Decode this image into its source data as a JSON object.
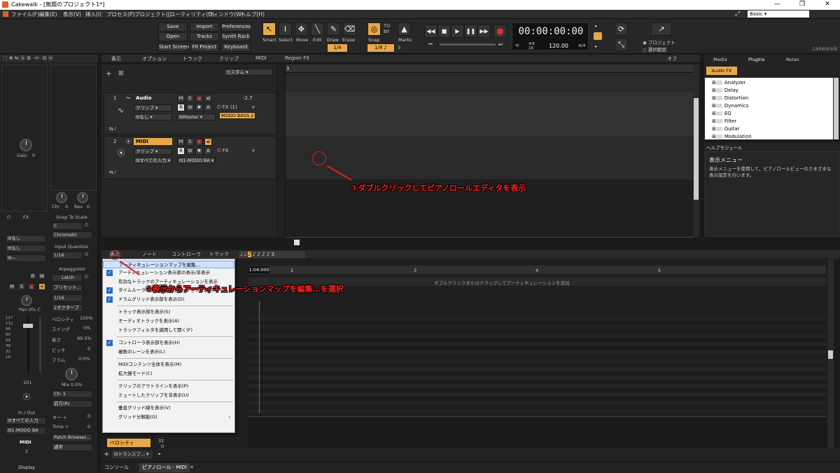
{
  "window": {
    "title": "Cakewalk - [無題のプロジェクト1*]",
    "min": "—",
    "max": "❐",
    "close": "✕",
    "workspace": "Basic"
  },
  "menu": [
    "ファイル(F)",
    "編集(E)",
    "表示(V)",
    "挿入(I)",
    "プロセス(P)",
    "プロジェクト(J)",
    "ユーティリティ(U)",
    "ウィンドウ(W)",
    "ヘルプ(H)"
  ],
  "control": {
    "buttons": [
      "Save",
      "Import",
      "Preferences",
      "Open",
      "Tracks",
      "Synth Rack",
      "Start Screen",
      "Fit Project",
      "Keyboard"
    ],
    "tools": [
      "Smart",
      "Select",
      "Move",
      "Edit",
      "Draw",
      "Erase"
    ],
    "snap": {
      "label": "Snap",
      "value": "1/8",
      "quantize": "1/4",
      "marks": "Marks"
    },
    "time": "00:00:00:00",
    "tempo": "120.00",
    "meter": "4/4",
    "meter_alt": "4/8",
    "meter_sub": "16",
    "beats_label": "3",
    "radio_project": "プロジェクト",
    "radio_selection": "選択範囲",
    "brand": "cakewalk"
  },
  "inspector": {
    "gain": "Gain",
    "gain_val": "0",
    "chr": "Chr",
    "chr_val": "0",
    "rev": "Rev",
    "rev_val": "0",
    "fx": "FX",
    "snap_to_scale": "Snap To Scale",
    "scale_key": "C",
    "scale_type": "Chromatic",
    "none1": "なし",
    "none2": "なし",
    "dash": "---",
    "input_quantize": "Input Quantize",
    "iq_value": "1/16",
    "arpeggiator": "Arpeggiator",
    "latch": "Latch",
    "preset": "プリセット…",
    "arp_rate": "1/16",
    "arp_octave": "2オクターブ",
    "pan": "Pan",
    "pan_val": "0% C",
    "velocity": "ベロシティ",
    "velocity_val": "100%",
    "swing": "スイング",
    "swing_val": "0%",
    "length": "長さ",
    "length_val": "99.5%",
    "pitch": "ピッチ",
    "pitch_val": "0",
    "flam": "フラム",
    "flam_val": "0.0%",
    "mix": "Mix",
    "mix_val": "0.0%",
    "ch": "Ch: 1",
    "direction": "前方(R)",
    "key_plus": "キー +",
    "key_val": "0",
    "time_plus": "Time +",
    "time_val": "0",
    "patch_browser": "Patch Browser...",
    "normal": "通常",
    "in_out": "In / Out",
    "input_all": "すべての入力",
    "output": "1-MODO BA",
    "track_type": "MIDI",
    "track_num": "2",
    "display": "Display",
    "fader_scale": [
      "127",
      "112",
      "96",
      "80",
      "64",
      "48",
      "32",
      "16"
    ],
    "fader_val": "101"
  },
  "trackview": {
    "menus": [
      "表示",
      "オプション",
      "トラック",
      "クリップ",
      "MIDI",
      "Region FX"
    ],
    "custom": "カスタム",
    "off": "オフ",
    "tracks": [
      {
        "num": "1",
        "name": "Audio",
        "vol": "-2.7",
        "clip": "クリップ",
        "fx": "FX (1)",
        "input": "なし",
        "output": "Master",
        "plugin": "MODO BASS 2"
      },
      {
        "num": "2",
        "name": "MIDI",
        "clip": "クリップ",
        "fx": "FX",
        "input": "すべての入力",
        "output": "1-MODO BA"
      }
    ],
    "annotation1": "①ダブルクリックしてピアノロールエディタを表示"
  },
  "browser": {
    "tabs": [
      "Media",
      "PlugIns",
      "Notes"
    ],
    "category": "Audio FX",
    "items": [
      "Analyzer",
      "Delay",
      "Distortion",
      "Dynamics",
      "EQ",
      "Filter",
      "Guitar",
      "Modulation"
    ]
  },
  "help": {
    "title": "ヘルプモジュール",
    "heading": "表示メニュー",
    "body": "表示メニューを使用して、ピアノロールビューのさまざまな表示設定を行います。"
  },
  "pianoroll": {
    "menus": [
      "表示",
      "ノート",
      "コントローラ",
      "トラック"
    ],
    "time": "1:04:000",
    "bars": [
      "2",
      "3",
      "4",
      "5"
    ],
    "hint": "ダブルクリックまたはドラッグしてアーティキュレーションを追加",
    "velocity": "ベロシティ",
    "transform": "トランスフ...",
    "ctl_val": "32",
    "ctl_zero": "0",
    "annotation2": "②表示からアーティキュレーションマップを編集…を選択"
  },
  "dropdown": [
    {
      "label": "アーティキュレーションマップを編集...",
      "checked": false,
      "highlight": true
    },
    {
      "label": "アーティキュレーション表示部の表示/非表示",
      "checked": true
    },
    {
      "label": "有効なトラックのアーティキュレーションを表示",
      "checked": false
    },
    {
      "label": "タイムルーラでアーティキュレーションを選択",
      "checked": true
    },
    {
      "label": "ドラムグリッド表示部を表示(D)",
      "checked": true
    },
    {
      "label": "トラック表示部を表示(S)",
      "checked": false
    },
    {
      "label": "オーディオトラックを表示(A)",
      "checked": false
    },
    {
      "label": "トラックフィルタを適用して開く(F)",
      "checked": false
    },
    {
      "label": "コントローラ表示部を表示(H)",
      "checked": true
    },
    {
      "label": "複数のレーンを表示(L)",
      "checked": false
    },
    {
      "label": "MIDIコンテンツ全体を表示(M)",
      "checked": false
    },
    {
      "label": "拡大鏡モード(C)",
      "checked": false
    },
    {
      "label": "クリップのアウトラインを表示(P)",
      "checked": false
    },
    {
      "label": "ミュートしたクリップを非表示(U)",
      "checked": false
    },
    {
      "label": "垂直グリッド線を表示(V)",
      "checked": false
    },
    {
      "label": "グリッド分解能(G)",
      "checked": false
    }
  ],
  "bottom_tabs": [
    "コンソール",
    "ピアノロール - MIDI"
  ]
}
